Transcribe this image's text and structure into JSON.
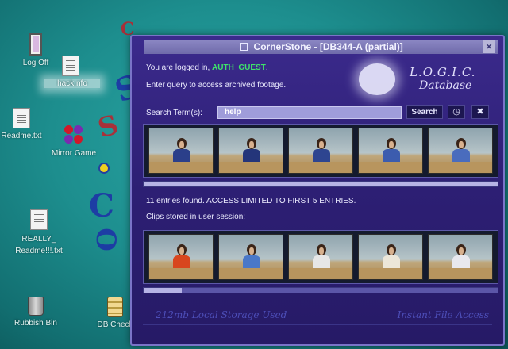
{
  "desktop": {
    "icons": [
      {
        "label": "Log Off",
        "icon": "door-icon"
      },
      {
        "label": "hack.nfo",
        "icon": "text-file-icon"
      },
      {
        "label": "Readme.txt",
        "icon": "text-file-icon"
      },
      {
        "label": "Mirror Game",
        "icon": "mirror-game-icon"
      },
      {
        "label": "REALLY_\nReadme!!!.txt",
        "icon": "text-file-icon"
      },
      {
        "label": "Rubbish Bin",
        "icon": "trash-icon"
      },
      {
        "label": "DB Check",
        "icon": "database-icon"
      }
    ]
  },
  "window": {
    "title": "CornerStone - [DB344-A (partial)]",
    "logged_in_prefix": "You are logged in, ",
    "username": "AUTH_GUEST",
    "logged_in_suffix": ".",
    "instructions": "Enter query to access archived footage.",
    "logo_line1": "L.O.G.I.C.",
    "logo_line2": "Database",
    "search_label": "Search Term(s):",
    "search_value": "help",
    "search_button": "Search",
    "results_message": "11 entries found. ACCESS LIMITED TO FIRST 5 ENTRIES.",
    "clips_label": "Clips stored in user session:",
    "footer_left": "212mb Local Storage Used",
    "footer_right": "Instant File Access"
  },
  "results": [
    {
      "name": "result-clip-1",
      "shirt": "#2b3f8a"
    },
    {
      "name": "result-clip-2",
      "shirt": "#24357a"
    },
    {
      "name": "result-clip-3",
      "shirt": "#2e4590"
    },
    {
      "name": "result-clip-4",
      "shirt": "#3c5cae"
    },
    {
      "name": "result-clip-5",
      "shirt": "#4a6cbd"
    }
  ],
  "stored_clips": [
    {
      "name": "stored-clip-1",
      "shirt": "#d8461e"
    },
    {
      "name": "stored-clip-2",
      "shirt": "#4a78c8"
    },
    {
      "name": "stored-clip-3",
      "shirt": "#e6e6e6"
    },
    {
      "name": "stored-clip-4",
      "shirt": "#ece6d8"
    },
    {
      "name": "stored-clip-5",
      "shirt": "#e8e8ee"
    }
  ],
  "colors": {
    "username": "#3ee36a",
    "window_bg": "#2d1f74"
  }
}
